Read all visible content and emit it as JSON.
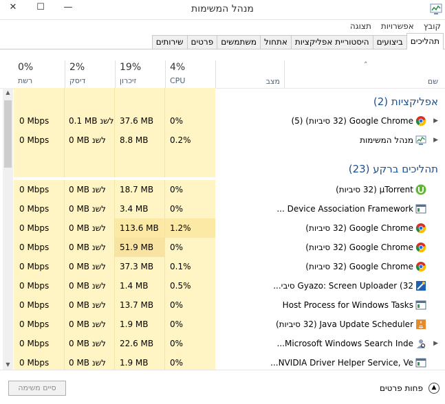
{
  "window": {
    "title": "מנהל המשימות",
    "minimize_glyph": "—",
    "maximize_glyph": "☐",
    "close_glyph": "✕"
  },
  "menubar": [
    "קובץ",
    "אפשרויות",
    "תצוגה"
  ],
  "tabs": [
    {
      "label": "תהליכים",
      "active": true
    },
    {
      "label": "ביצועים"
    },
    {
      "label": "היסטוריית אפליקציות"
    },
    {
      "label": "אתחול"
    },
    {
      "label": "משתמשים"
    },
    {
      "label": "פרטים"
    },
    {
      "label": "שירותים"
    }
  ],
  "columns": {
    "name": {
      "label": "שם",
      "sort_glyph": "˄"
    },
    "status": {
      "label": "מצב"
    },
    "cpu": {
      "pct": "4%",
      "label": "CPU"
    },
    "memory": {
      "pct": "19%",
      "label": "זיכרון"
    },
    "disk": {
      "pct": "2%",
      "label": "דיסק"
    },
    "network": {
      "pct": "0%",
      "label": "רשת"
    }
  },
  "groups": [
    {
      "title": "אפליקציות (2)"
    },
    {
      "title": "תהליכים ברקע (23)"
    }
  ],
  "rows": [
    {
      "name": "Google Chrome (32 סיביות) (5)",
      "icon": "chrome-icon",
      "expandable": true,
      "cpu": "0%",
      "memory": "37.6 MB",
      "disk": "0.1 MB לשנ",
      "network": "0 Mbps"
    },
    {
      "name": "מנהל המשימות",
      "icon": "task-manager-icon",
      "expandable": true,
      "cpu": "0.2%",
      "memory": "8.8 MB",
      "disk": "0 MB לשנ",
      "network": "0 Mbps"
    },
    {
      "name": "μTorrent (32 סיביות)",
      "icon": "utorrent-icon",
      "cpu": "0%",
      "memory": "18.7 MB",
      "disk": "0 MB לשנ",
      "network": "0 Mbps"
    },
    {
      "name": "Device Association Framework ...",
      "icon": "service-window-icon",
      "cpu": "0%",
      "memory": "3.4 MB",
      "disk": "0 MB לשנ",
      "network": "0 Mbps"
    },
    {
      "name": "Google Chrome (32 סיביות)",
      "icon": "chrome-icon",
      "cpu": "1.2%",
      "memory": "113.6 MB",
      "disk": "0 MB לשנ",
      "network": "0 Mbps"
    },
    {
      "name": "Google Chrome (32 סיביות)",
      "icon": "chrome-icon",
      "cpu": "0%",
      "memory": "51.9 MB",
      "disk": "0 MB לשנ",
      "network": "0 Mbps"
    },
    {
      "name": "Google Chrome (32 סיביות)",
      "icon": "chrome-icon",
      "cpu": "0.1%",
      "memory": "37.3 MB",
      "disk": "0 MB לשנ",
      "network": "0 Mbps"
    },
    {
      "name": "Gyazo: Screen Uploader (32 סיבי...",
      "icon": "gyazo-icon",
      "cpu": "0.5%",
      "memory": "1.4 MB",
      "disk": "0 MB לשנ",
      "network": "0 Mbps"
    },
    {
      "name": "Host Process for Windows Tasks",
      "icon": "service-window-icon",
      "cpu": "0%",
      "memory": "13.7 MB",
      "disk": "0 MB לשנ",
      "network": "0 Mbps"
    },
    {
      "name": "Java Update Scheduler (32 סיביות)",
      "icon": "java-icon",
      "cpu": "0%",
      "memory": "1.9 MB",
      "disk": "0 MB לשנ",
      "network": "0 Mbps"
    },
    {
      "name": "Microsoft Windows Search Inde...",
      "icon": "search-indexer-icon",
      "expandable": true,
      "cpu": "0%",
      "memory": "22.6 MB",
      "disk": "0 MB לשנ",
      "network": "0 Mbps"
    },
    {
      "name": "NVIDIA Driver Helper Service, Ve...",
      "icon": "service-window-icon",
      "cpu": "0%",
      "memory": "1.9 MB",
      "disk": "0 MB לשנ",
      "network": "0 Mbps"
    }
  ],
  "footer": {
    "fewer_details": "פחות פרטים",
    "end_task": "סיים משימה"
  }
}
